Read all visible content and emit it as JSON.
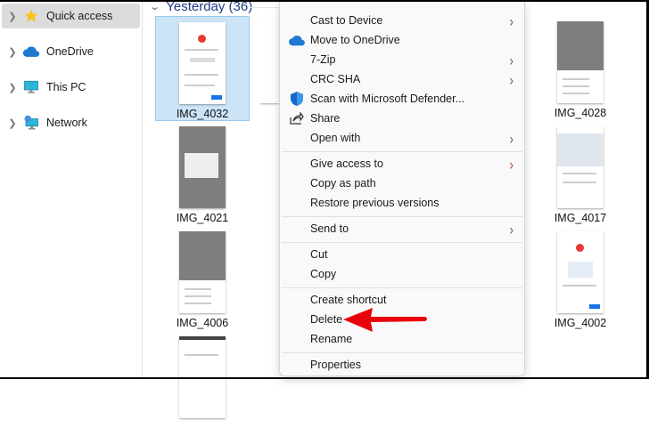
{
  "sidebar": {
    "items": [
      {
        "label": "Quick access",
        "icon": "star-icon",
        "selected": true
      },
      {
        "label": "OneDrive",
        "icon": "cloud-icon"
      },
      {
        "label": "This PC",
        "icon": "monitor-icon"
      },
      {
        "label": "Network",
        "icon": "network-icon"
      }
    ]
  },
  "group": {
    "label": "Yesterday (36)"
  },
  "files": [
    "IMG_4032",
    "IMG_4028",
    "IMG_4021",
    "IMG_4017",
    "IMG_4006",
    "IMG_4002"
  ],
  "menu": {
    "items": [
      {
        "label": "Cast to Device",
        "submenu": true
      },
      {
        "label": "Move to OneDrive",
        "icon": "onedrive-icon"
      },
      {
        "label": "7-Zip",
        "submenu": true
      },
      {
        "label": "CRC SHA",
        "submenu": true
      },
      {
        "label": "Scan with Microsoft Defender...",
        "icon": "defender-shield-icon"
      },
      {
        "label": "Share",
        "icon": "share-icon"
      },
      {
        "label": "Open with",
        "submenu": true
      },
      {
        "label": "Give access to",
        "submenu": true
      },
      {
        "label": "Copy as path"
      },
      {
        "label": "Restore previous versions"
      },
      {
        "label": "Send to",
        "submenu": true
      },
      {
        "label": "Cut"
      },
      {
        "label": "Copy"
      },
      {
        "label": "Create shortcut"
      },
      {
        "label": "Delete"
      },
      {
        "label": "Rename"
      },
      {
        "label": "Properties"
      }
    ]
  },
  "colors": {
    "accent": "#1e3a8a",
    "selection": "#cce4f7",
    "arrow": "#e8000b"
  }
}
